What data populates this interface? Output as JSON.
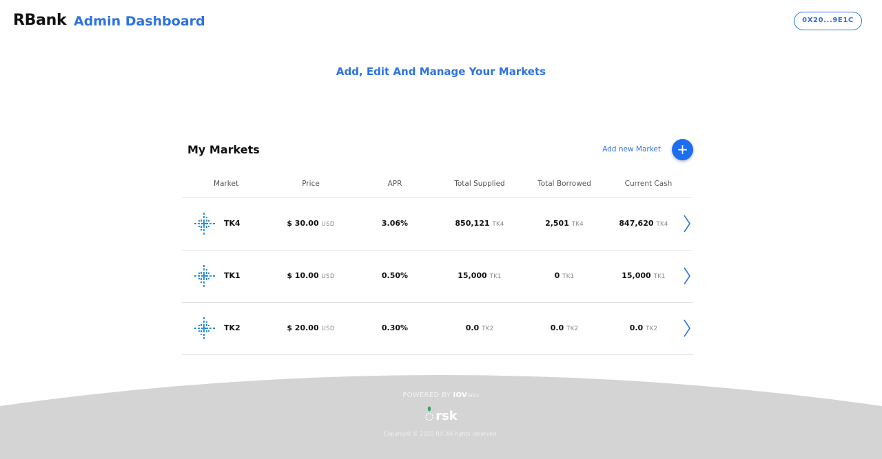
{
  "header": {
    "brand": "RBank",
    "title": "Admin Dashboard",
    "wallet": "0X20...9E1C"
  },
  "subtitle": "Add, Edit And Manage Your Markets",
  "markets": {
    "title": "My Markets",
    "add_label": "Add new Market",
    "add_icon": "plus-icon",
    "columns": [
      "Market",
      "Price",
      "APR",
      "Total Supplied",
      "Total Borrowed",
      "Current Cash"
    ],
    "rows": [
      {
        "token": "TK4",
        "price": "$ 30.00",
        "price_unit": "USD",
        "apr": "3.06%",
        "supplied": "850,121",
        "borrowed": "2,501",
        "cash": "847,620"
      },
      {
        "token": "TK1",
        "price": "$ 10.00",
        "price_unit": "USD",
        "apr": "0.50%",
        "supplied": "15,000",
        "borrowed": "0",
        "cash": "15,000"
      },
      {
        "token": "TK2",
        "price": "$ 20.00",
        "price_unit": "USD",
        "apr": "0.30%",
        "supplied": "0.0",
        "borrowed": "0.0",
        "cash": "0.0"
      }
    ]
  },
  "footer": {
    "powered_prefix": "POWERED BY",
    "powered_brand": "IOV",
    "powered_suffix": "labs",
    "logo_text": "rsk",
    "copyright": "Copyright © 2020 Rif. All rights reserved."
  },
  "colors": {
    "accent": "#2d73e0",
    "fab": "#1d6ef0",
    "footer_bg": "#d4d4d4",
    "token_icon": "#2e8fd6"
  }
}
